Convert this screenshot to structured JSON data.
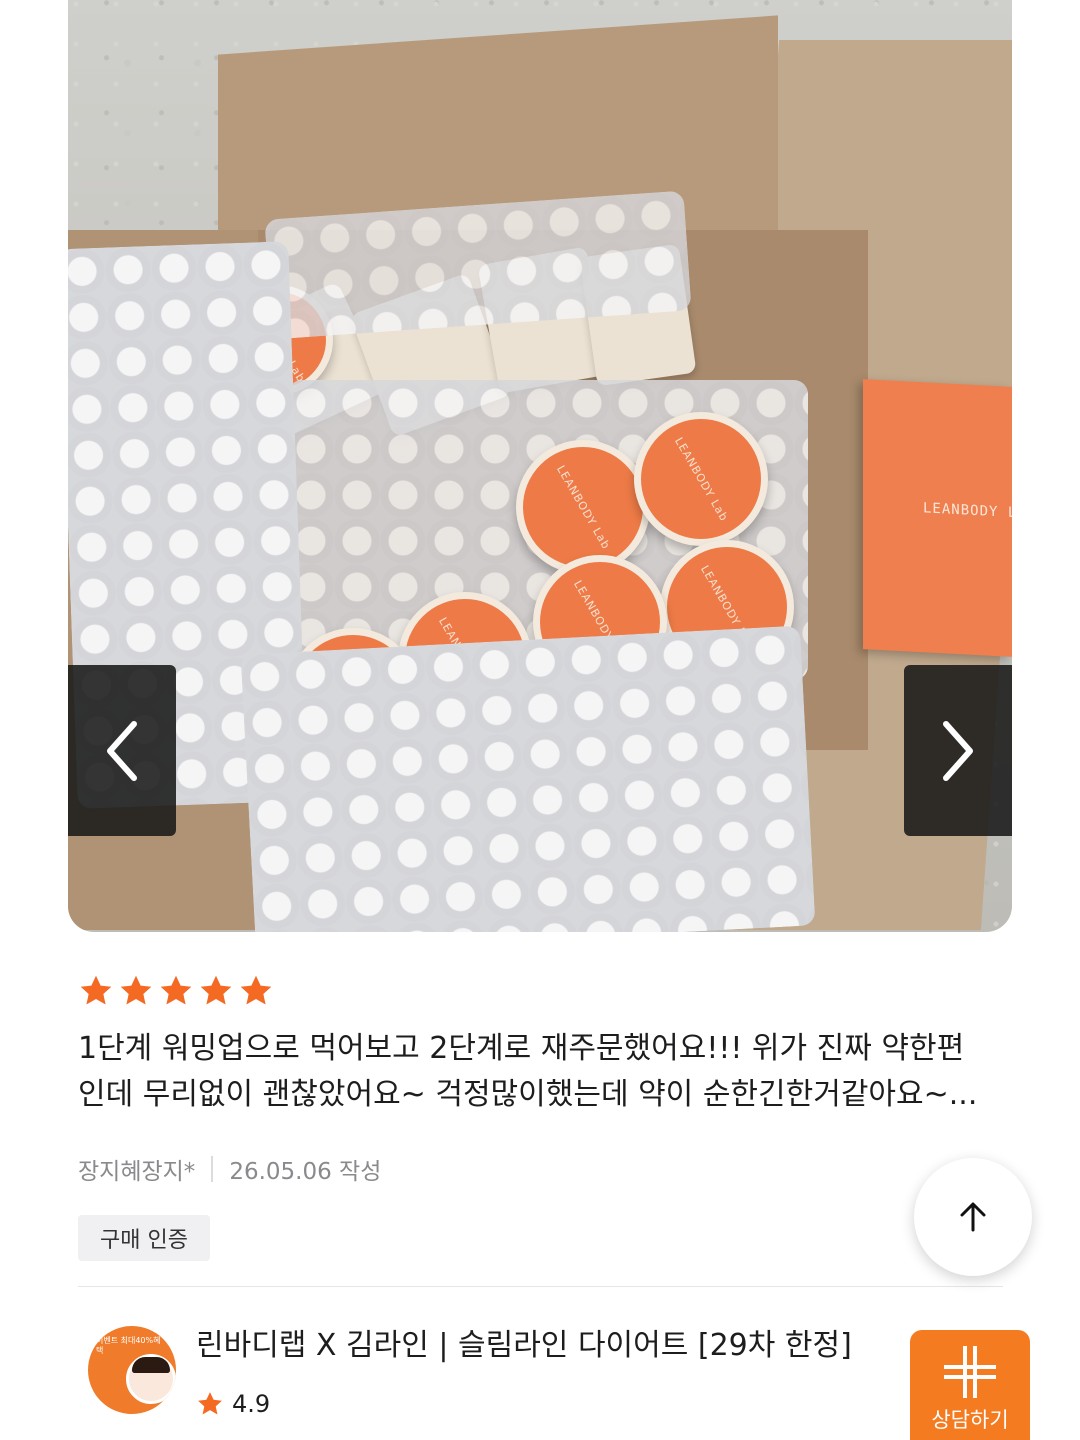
{
  "gallery": {
    "photo_alt": "리뷰 사진",
    "prev_icon": "chevron-left-icon",
    "next_icon": "chevron-right-icon",
    "tub_brand": "LEANBODY Lab",
    "booklet_brand": "LEANBODY Lab"
  },
  "review": {
    "rating": 5,
    "text": "1단계 워밍업으로 먹어보고 2단계로 재주문했어요!!! 위가 진짜 약한편\n인데 무리없이 괜찮았어요~ 걱정많이했는데 약이 순한긴한거같아요~...",
    "author": "장지혜장지*",
    "date": "26.05.06 작성",
    "badge": "구매 인증"
  },
  "scroll_top": {
    "icon": "arrow-up-icon"
  },
  "product": {
    "thumb_promo": "이벤트 최대40%혜택",
    "title": "린바디랩 X 김라인 | 슬림라인 다이어트 [29차 한정]",
    "rating": "4.9",
    "consult_label": "상담하기"
  },
  "colors": {
    "star": "#f46a22",
    "consult_bg": "#f47b20",
    "text_primary": "#1d1d1f",
    "text_secondary": "#8a8a8e"
  }
}
